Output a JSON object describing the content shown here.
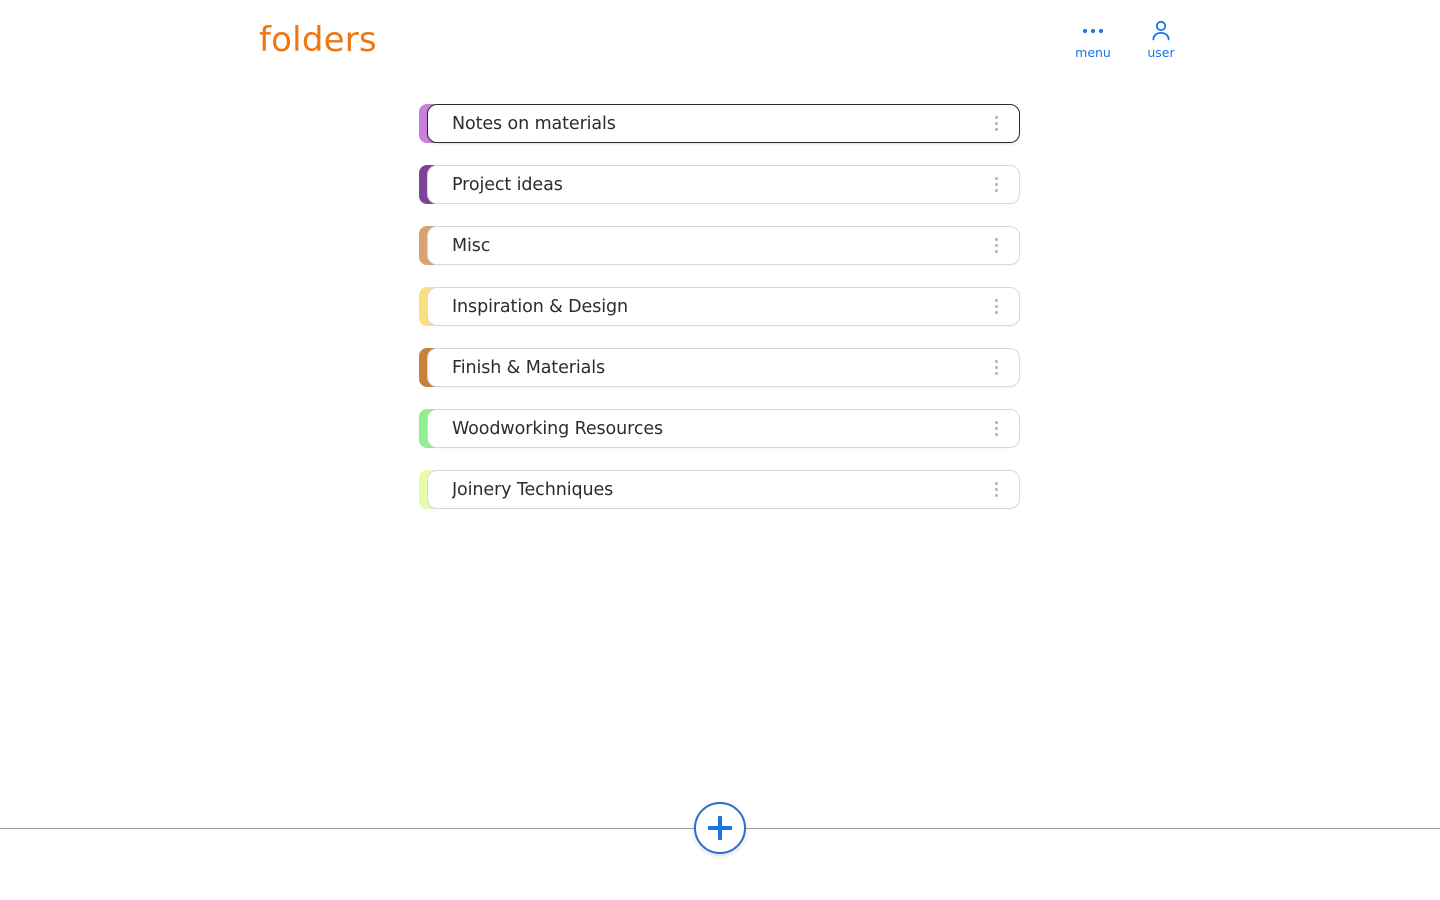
{
  "header": {
    "brand": "folders",
    "actions": [
      {
        "label": "menu",
        "icon": "more-horizontal-icon"
      },
      {
        "label": "user",
        "icon": "user-account-icon"
      }
    ]
  },
  "folders": {
    "row_menu_icon": "more-vertical-icon",
    "items": [
      {
        "name": "Notes on materials",
        "color": "#c87fdd",
        "active": true
      },
      {
        "name": "Project ideas",
        "color": "#7c4499",
        "active": false
      },
      {
        "name": "Misc",
        "color": "#d9a273",
        "active": false
      },
      {
        "name": "Inspiration & Design",
        "color": "#f7e07f",
        "active": false
      },
      {
        "name": "Finish & Materials",
        "color": "#c8803c",
        "active": false
      },
      {
        "name": "Woodworking Resources",
        "color": "#8ef08e",
        "active": false
      },
      {
        "name": "Joinery Techniques",
        "color": "#e8fba8",
        "active": false
      }
    ]
  },
  "footer": {
    "add_button": {
      "label": "+",
      "icon": "plus-icon",
      "accent": "#1a73e8"
    }
  },
  "theme": {
    "brand_color": "#ee7711",
    "accent_color": "#1a73e8",
    "divider_color": "#9b9ba1",
    "card_border": "#d8d8d8",
    "card_border_active": "#2b2b2b",
    "text_color": "#2c2c2c",
    "background": "#ffffff"
  }
}
